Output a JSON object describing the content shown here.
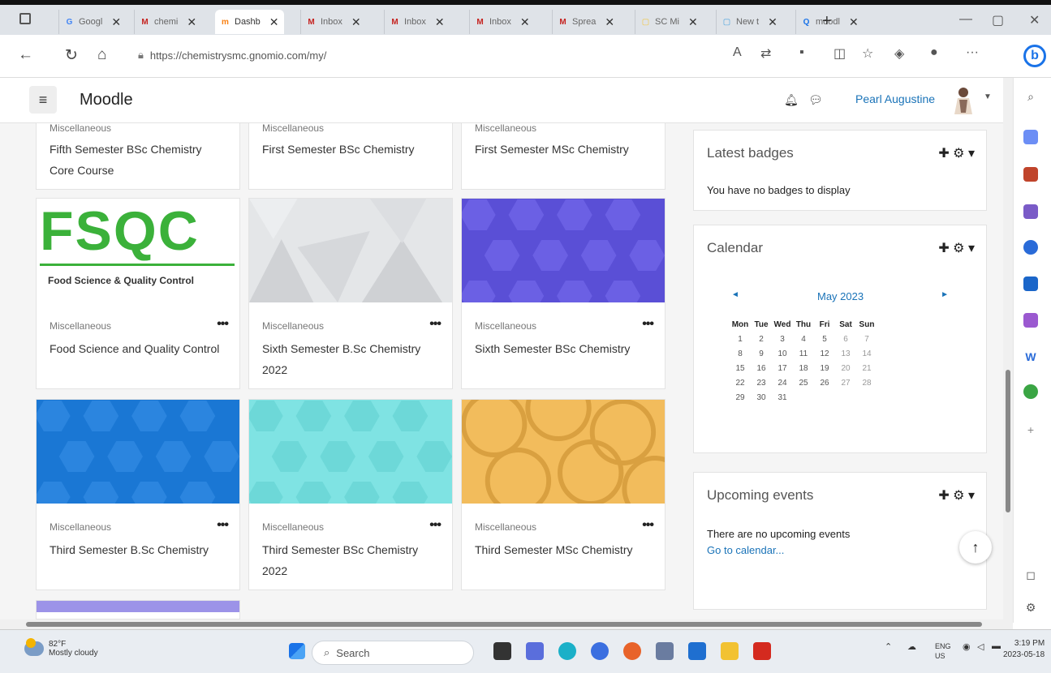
{
  "browser": {
    "tabs": [
      {
        "label": "Googl",
        "favicon": "G",
        "color": "#4285f4"
      },
      {
        "label": "chemi",
        "favicon": "M",
        "color": "#c5221f"
      },
      {
        "label": "Dashb",
        "favicon": "m",
        "color": "#f98012",
        "active": true
      },
      {
        "label": "Inbox",
        "favicon": "M",
        "color": "#c5221f"
      },
      {
        "label": "Inbox",
        "favicon": "M",
        "color": "#c5221f"
      },
      {
        "label": "Inbox",
        "favicon": "M",
        "color": "#c5221f"
      },
      {
        "label": "Sprea",
        "favicon": "M",
        "color": "#c5221f"
      },
      {
        "label": "SC Mi",
        "favicon": "▢",
        "color": "#f2c744"
      },
      {
        "label": "New t",
        "favicon": "▢",
        "color": "#4aa3df"
      },
      {
        "label": "moodl",
        "favicon": "Q",
        "color": "#1a73e8"
      }
    ],
    "url": "https://chemistrysmc.gnomio.com/my/"
  },
  "header": {
    "brand": "Moodle",
    "user": "Pearl Augustine"
  },
  "courses_top": [
    {
      "category": "Miscellaneous",
      "name": "Fifth Semester BSc Chemistry Core Course"
    },
    {
      "category": "Miscellaneous",
      "name": "First Semester BSc Chemistry"
    },
    {
      "category": "Miscellaneous",
      "name": "First Semester MSc Chemistry"
    }
  ],
  "courses_mid": [
    {
      "category": "Miscellaneous",
      "name": "Food Science and Quality Control",
      "image": "fsqc"
    },
    {
      "category": "Miscellaneous",
      "name": "Sixth Semester B.Sc Chemistry 2022",
      "image": "grey"
    },
    {
      "category": "Miscellaneous",
      "name": "Sixth Semester BSc Chemistry",
      "image": "purple"
    }
  ],
  "courses_bottom": [
    {
      "category": "Miscellaneous",
      "name": "Third Semester B.Sc Chemistry",
      "image": "blue"
    },
    {
      "category": "Miscellaneous",
      "name": "Third Semester BSc Chemistry 2022",
      "image": "teal"
    },
    {
      "category": "Miscellaneous",
      "name": "Third Semester MSc Chemistry",
      "image": "orange"
    }
  ],
  "fsqc": {
    "big": "FSQC",
    "sub": "Food Science & Quality Control"
  },
  "blocks": {
    "badges": {
      "title": "Latest badges",
      "text": "You have no badges to display"
    },
    "calendar": {
      "title": "Calendar",
      "month": "May 2023",
      "weekdays": [
        "Mon",
        "Tue",
        "Wed",
        "Thu",
        "Fri",
        "Sat",
        "Sun"
      ],
      "weeks": [
        [
          "1",
          "2",
          "3",
          "4",
          "5",
          "6",
          "7"
        ],
        [
          "8",
          "9",
          "10",
          "11",
          "12",
          "13",
          "14"
        ],
        [
          "15",
          "16",
          "17",
          "18",
          "19",
          "20",
          "21"
        ],
        [
          "22",
          "23",
          "24",
          "25",
          "26",
          "27",
          "28"
        ],
        [
          "29",
          "30",
          "31",
          "",
          "",
          "",
          ""
        ]
      ]
    },
    "upcoming": {
      "title": "Upcoming events",
      "text": "There are no upcoming events",
      "link": "Go to calendar..."
    }
  },
  "taskbar": {
    "temp": "82°F",
    "weather": "Mostly cloudy",
    "search": "Search",
    "lang1": "ENG",
    "lang2": "US",
    "time": "3:19 PM",
    "date": "2023-05-18"
  }
}
